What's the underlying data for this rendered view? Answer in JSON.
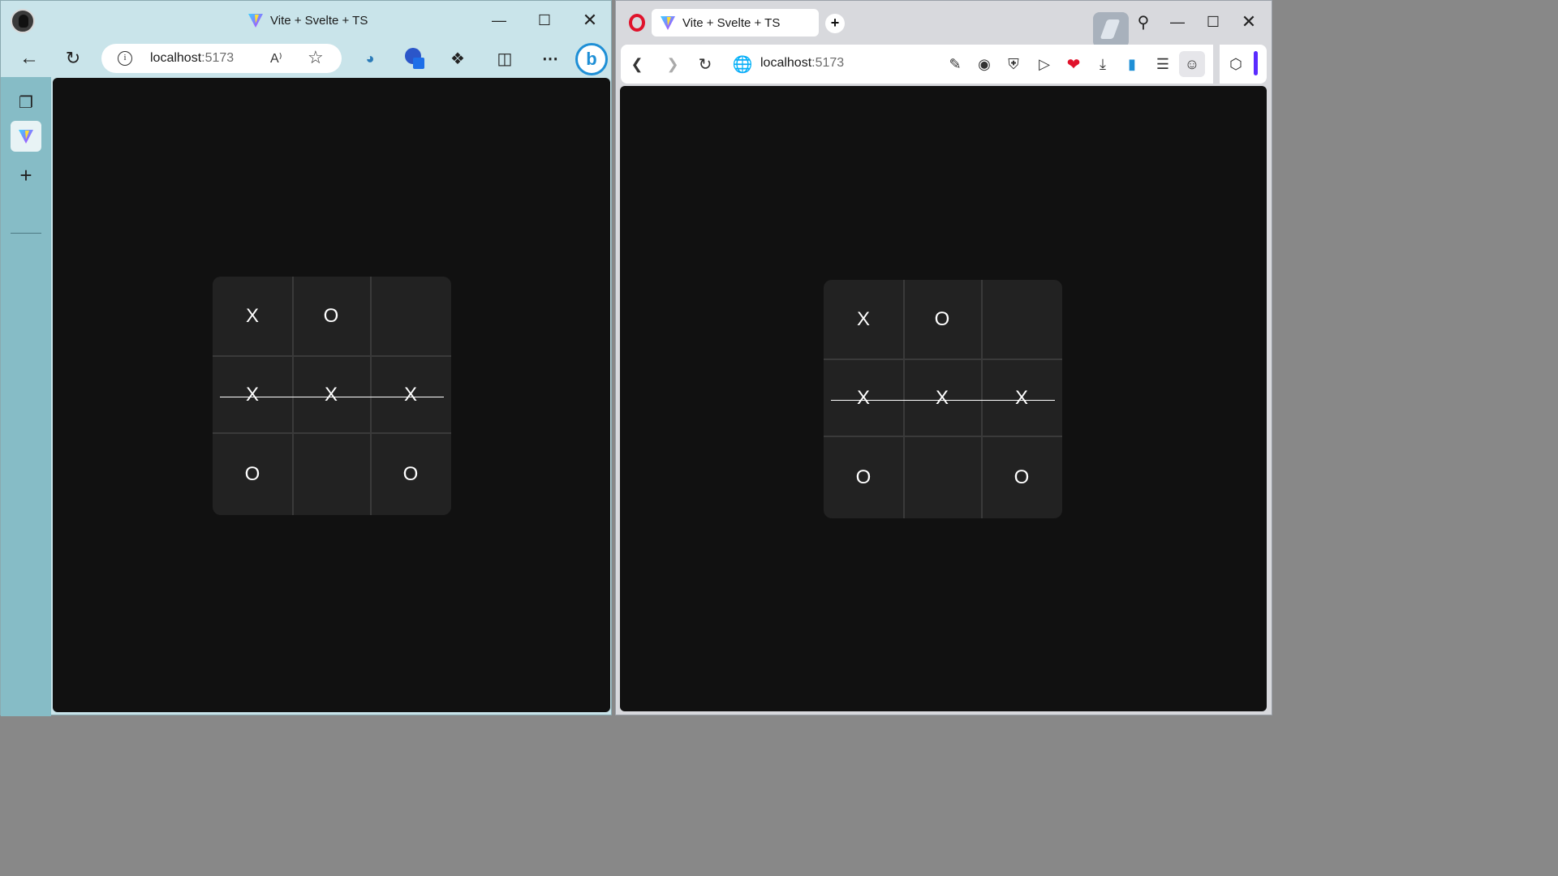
{
  "edge": {
    "tab_title": "Vite + Svelte + TS",
    "url_host": "localhost",
    "url_port": ":5173",
    "read_aloud_label": "A⁾"
  },
  "opera": {
    "tab_title": "Vite + Svelte + TS",
    "url_host": "localhost",
    "url_port": ":5173"
  },
  "game": {
    "board": [
      "X",
      "O",
      "",
      "X",
      "X",
      "X",
      "O",
      "",
      "O"
    ],
    "winning_row": 1,
    "winner": "X"
  },
  "colors": {
    "page_bg": "#111111",
    "board_bg": "#222222",
    "grid_line": "#3a3a3a",
    "mark": "#ffffff",
    "edge_chrome": "#c9e4ea",
    "edge_sidebar": "#86bcc6",
    "opera_chrome": "#d8d9dd",
    "opera_logo": "#e0122b"
  }
}
